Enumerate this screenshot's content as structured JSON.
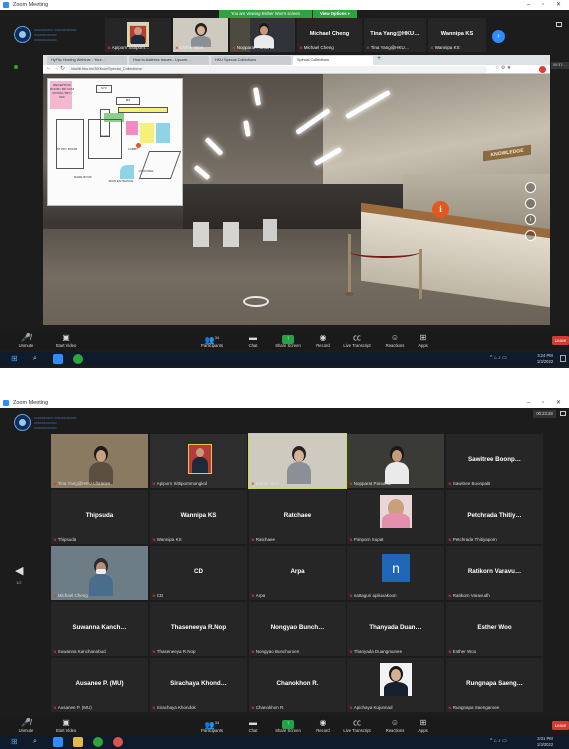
{
  "top": {
    "window_title": "Zoom Meeting",
    "banner": {
      "text": "You are viewing Esther Woo's screen",
      "view_options": "View Options ▾",
      "color": "#2ea43b"
    },
    "filmstrip": [
      {
        "name": "Apiporn Sittiporn…",
        "type": "video"
      },
      {
        "name": "Esther Woo",
        "type": "video"
      },
      {
        "name": "Nopparat Panuthai",
        "type": "video"
      },
      {
        "name": "Michael Cheng",
        "type": "name"
      },
      {
        "name": "Tina Yang@HKU…",
        "type": "name"
      },
      {
        "name": "Wannipa KS",
        "type": "name"
      }
    ],
    "timer": "00:37:…",
    "browser": {
      "tabs": [
        "HyFlip Hosting Webinar - Your…",
        "How to Address Issues - Upcom…",
        "HKU Special Collections"
      ],
      "active_tab": "Special Collections",
      "url": "hkulib.hku.hk/360tour/Special_Collections/",
      "plan_labels": [
        "RECEPTION ROOM / MF COM / ROOM / BFT / OFF",
        "SYC",
        "MS",
        "LOBBY",
        "STUDY",
        "COUNTER",
        "MAIN ENTRANCE",
        "STUDY ROOM",
        "RARE BOOK"
      ],
      "sign": "KNOWLEDGE",
      "hotspot": "i"
    },
    "toolbar": {
      "unmute": "Unmute",
      "start_video": "Start Video",
      "participants": "Participants",
      "participants_count": "34",
      "chat": "Chat",
      "share_screen": "Share Screen",
      "record": "Record",
      "live_transcript": "Live Transcript",
      "reactions": "Reactions",
      "apps": "Apps",
      "leave": "Leave"
    },
    "taskbar": {
      "time": "3:24 PM",
      "date": "1/3/2022"
    }
  },
  "bottom": {
    "window_title": "Zoom Meeting",
    "timer": "00:23:28",
    "page_left": "1/2",
    "tiles": [
      {
        "name": "Tina Yang@HKU Libraries",
        "type": "video"
      },
      {
        "name": "Apiporn Sittipornmongkol",
        "type": "video"
      },
      {
        "name": "Esther Woo",
        "type": "video",
        "speaking": true
      },
      {
        "name": "Nopparat Panuthai",
        "type": "video"
      },
      {
        "big": "Sawitree Boonp…",
        "name": "Sawitree Boonpalit",
        "type": "name"
      },
      {
        "big": "Thipsuda",
        "name": "Thipsuda",
        "type": "name"
      },
      {
        "big": "Wannipa KS",
        "name": "Wannipa KS",
        "type": "name"
      },
      {
        "big": "Ratchaee",
        "name": "Ratchaee",
        "type": "name"
      },
      {
        "name": "Pimporn Supat",
        "type": "photo"
      },
      {
        "big": "Petchrada Thitiy…",
        "name": "Petchrada Thitiyaporn",
        "type": "name"
      },
      {
        "name": "Michael Cheng",
        "type": "video"
      },
      {
        "big": "CD",
        "name": "CD",
        "type": "name"
      },
      {
        "big": "Arpa",
        "name": "Arpa",
        "type": "name"
      },
      {
        "name": "nattaguri apiluxakoon",
        "type": "avatar",
        "letter": "n"
      },
      {
        "big": "Ratikorn Varavu…",
        "name": "Ratikorn Varavudh",
        "type": "name"
      },
      {
        "big": "Suwanna Kanch…",
        "name": "Suwanna Kanchanabud",
        "type": "name"
      },
      {
        "big": "Thaseneeya R.Nop",
        "name": "Thaseneeya R.Nop",
        "type": "name"
      },
      {
        "big": "Nongyao Bunch…",
        "name": "Nongyao Bunchuroen",
        "type": "name"
      },
      {
        "big": "Thanyada Duan…",
        "name": "Thanyada Duangmunee",
        "type": "name"
      },
      {
        "big": "Esther Woo",
        "name": "Esther Woo",
        "type": "name"
      },
      {
        "big": "Ausanee P. (MU)",
        "name": "Ausanee P. (MU)",
        "type": "name"
      },
      {
        "big": "Sirachaya Khond…",
        "name": "Sirachaya Khondok",
        "type": "name"
      },
      {
        "big": "Chanokhon R.",
        "name": "Chanokhon R.",
        "type": "name"
      },
      {
        "name": "Apichaya Kujunnad",
        "type": "photo2"
      },
      {
        "big": "Rungnapa Saeng…",
        "name": "Rungnapa Saengaroee",
        "type": "name"
      }
    ],
    "toolbar": {
      "unmute": "Unmute",
      "start_video": "Start Video",
      "participants": "Participants",
      "participants_count": "34",
      "chat": "Chat",
      "share_screen": "Share Screen",
      "record": "Record",
      "live_transcript": "Live Transcript",
      "reactions": "Reactions",
      "apps": "Apps",
      "leave": "Leave"
    },
    "taskbar": {
      "time": "3:01 PM",
      "date": "1/3/2022"
    }
  }
}
